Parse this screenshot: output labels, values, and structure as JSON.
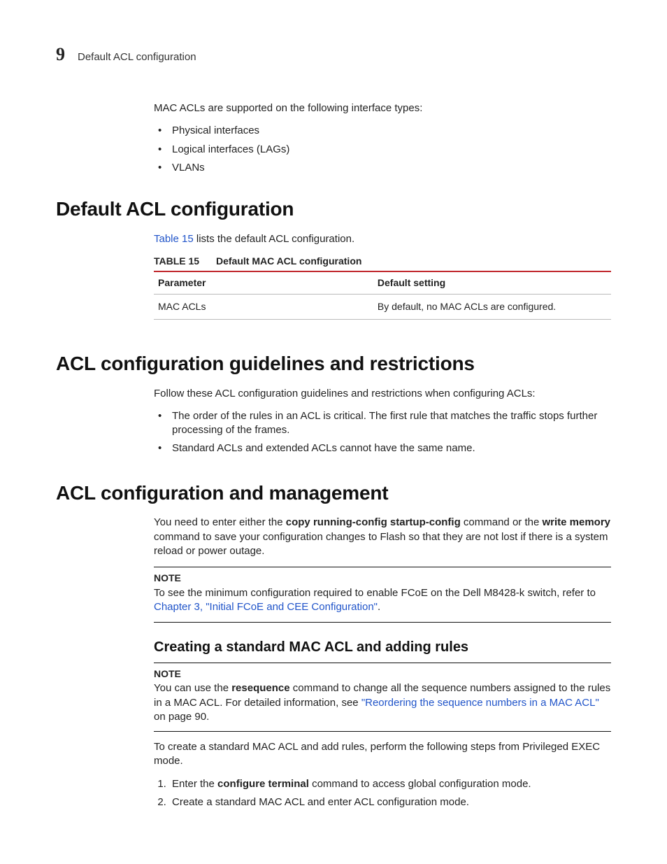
{
  "header": {
    "chapter_number": "9",
    "running_title": "Default ACL configuration"
  },
  "intro": {
    "para": "MAC ACLs are supported on the following interface types:",
    "bullets": [
      "Physical interfaces",
      "Logical interfaces (LAGs)",
      "VLANs"
    ]
  },
  "sec_default": {
    "heading": "Default ACL configuration",
    "para_pre": "",
    "link_text": "Table 15",
    "para_post": " lists the default ACL configuration.",
    "table": {
      "id": "TABLE 15",
      "title": "Default MAC ACL configuration",
      "head": [
        "Parameter",
        "Default setting"
      ],
      "rows": [
        [
          "MAC ACLs",
          "By default, no MAC ACLs are configured."
        ]
      ]
    }
  },
  "sec_guidelines": {
    "heading": "ACL configuration guidelines and restrictions",
    "para": "Follow these ACL configuration guidelines and restrictions when configuring ACLs:",
    "bullets": [
      "The order of the rules in an ACL is critical. The first rule that matches the traffic stops further processing of the frames.",
      "Standard ACLs and extended ACLs cannot have the same name."
    ]
  },
  "sec_mgmt": {
    "heading": "ACL configuration and management",
    "para1_a": "You need to enter either the ",
    "para1_b": "copy running-config startup-config",
    "para1_c": " command or the ",
    "para1_d": "write memory",
    "para1_e": " command to save your configuration changes to Flash so that they are not lost if there is a system reload or power outage.",
    "note1": {
      "label": "NOTE",
      "text_a": "To see the minimum configuration required to enable FCoE on the Dell M8428-k switch, refer to ",
      "link": "Chapter 3, \"Initial FCoE and CEE Configuration\"",
      "text_b": "."
    },
    "sub_heading": "Creating a standard MAC ACL and adding rules",
    "note2": {
      "label": "NOTE",
      "text_a": "You can use the ",
      "bold": "resequence",
      "text_b": " command to change all the sequence numbers assigned to the rules in a MAC ACL. For detailed information, see ",
      "link": "\"Reordering the sequence numbers in a MAC ACL\"",
      "text_c": " on page 90."
    },
    "para2": "To create a standard MAC ACL and add rules, perform the following steps from Privileged EXEC mode.",
    "steps": {
      "s1_a": "Enter the ",
      "s1_b": "configure terminal",
      "s1_c": " command to access global configuration mode.",
      "s2": "Create a standard MAC ACL and enter ACL configuration mode."
    }
  }
}
